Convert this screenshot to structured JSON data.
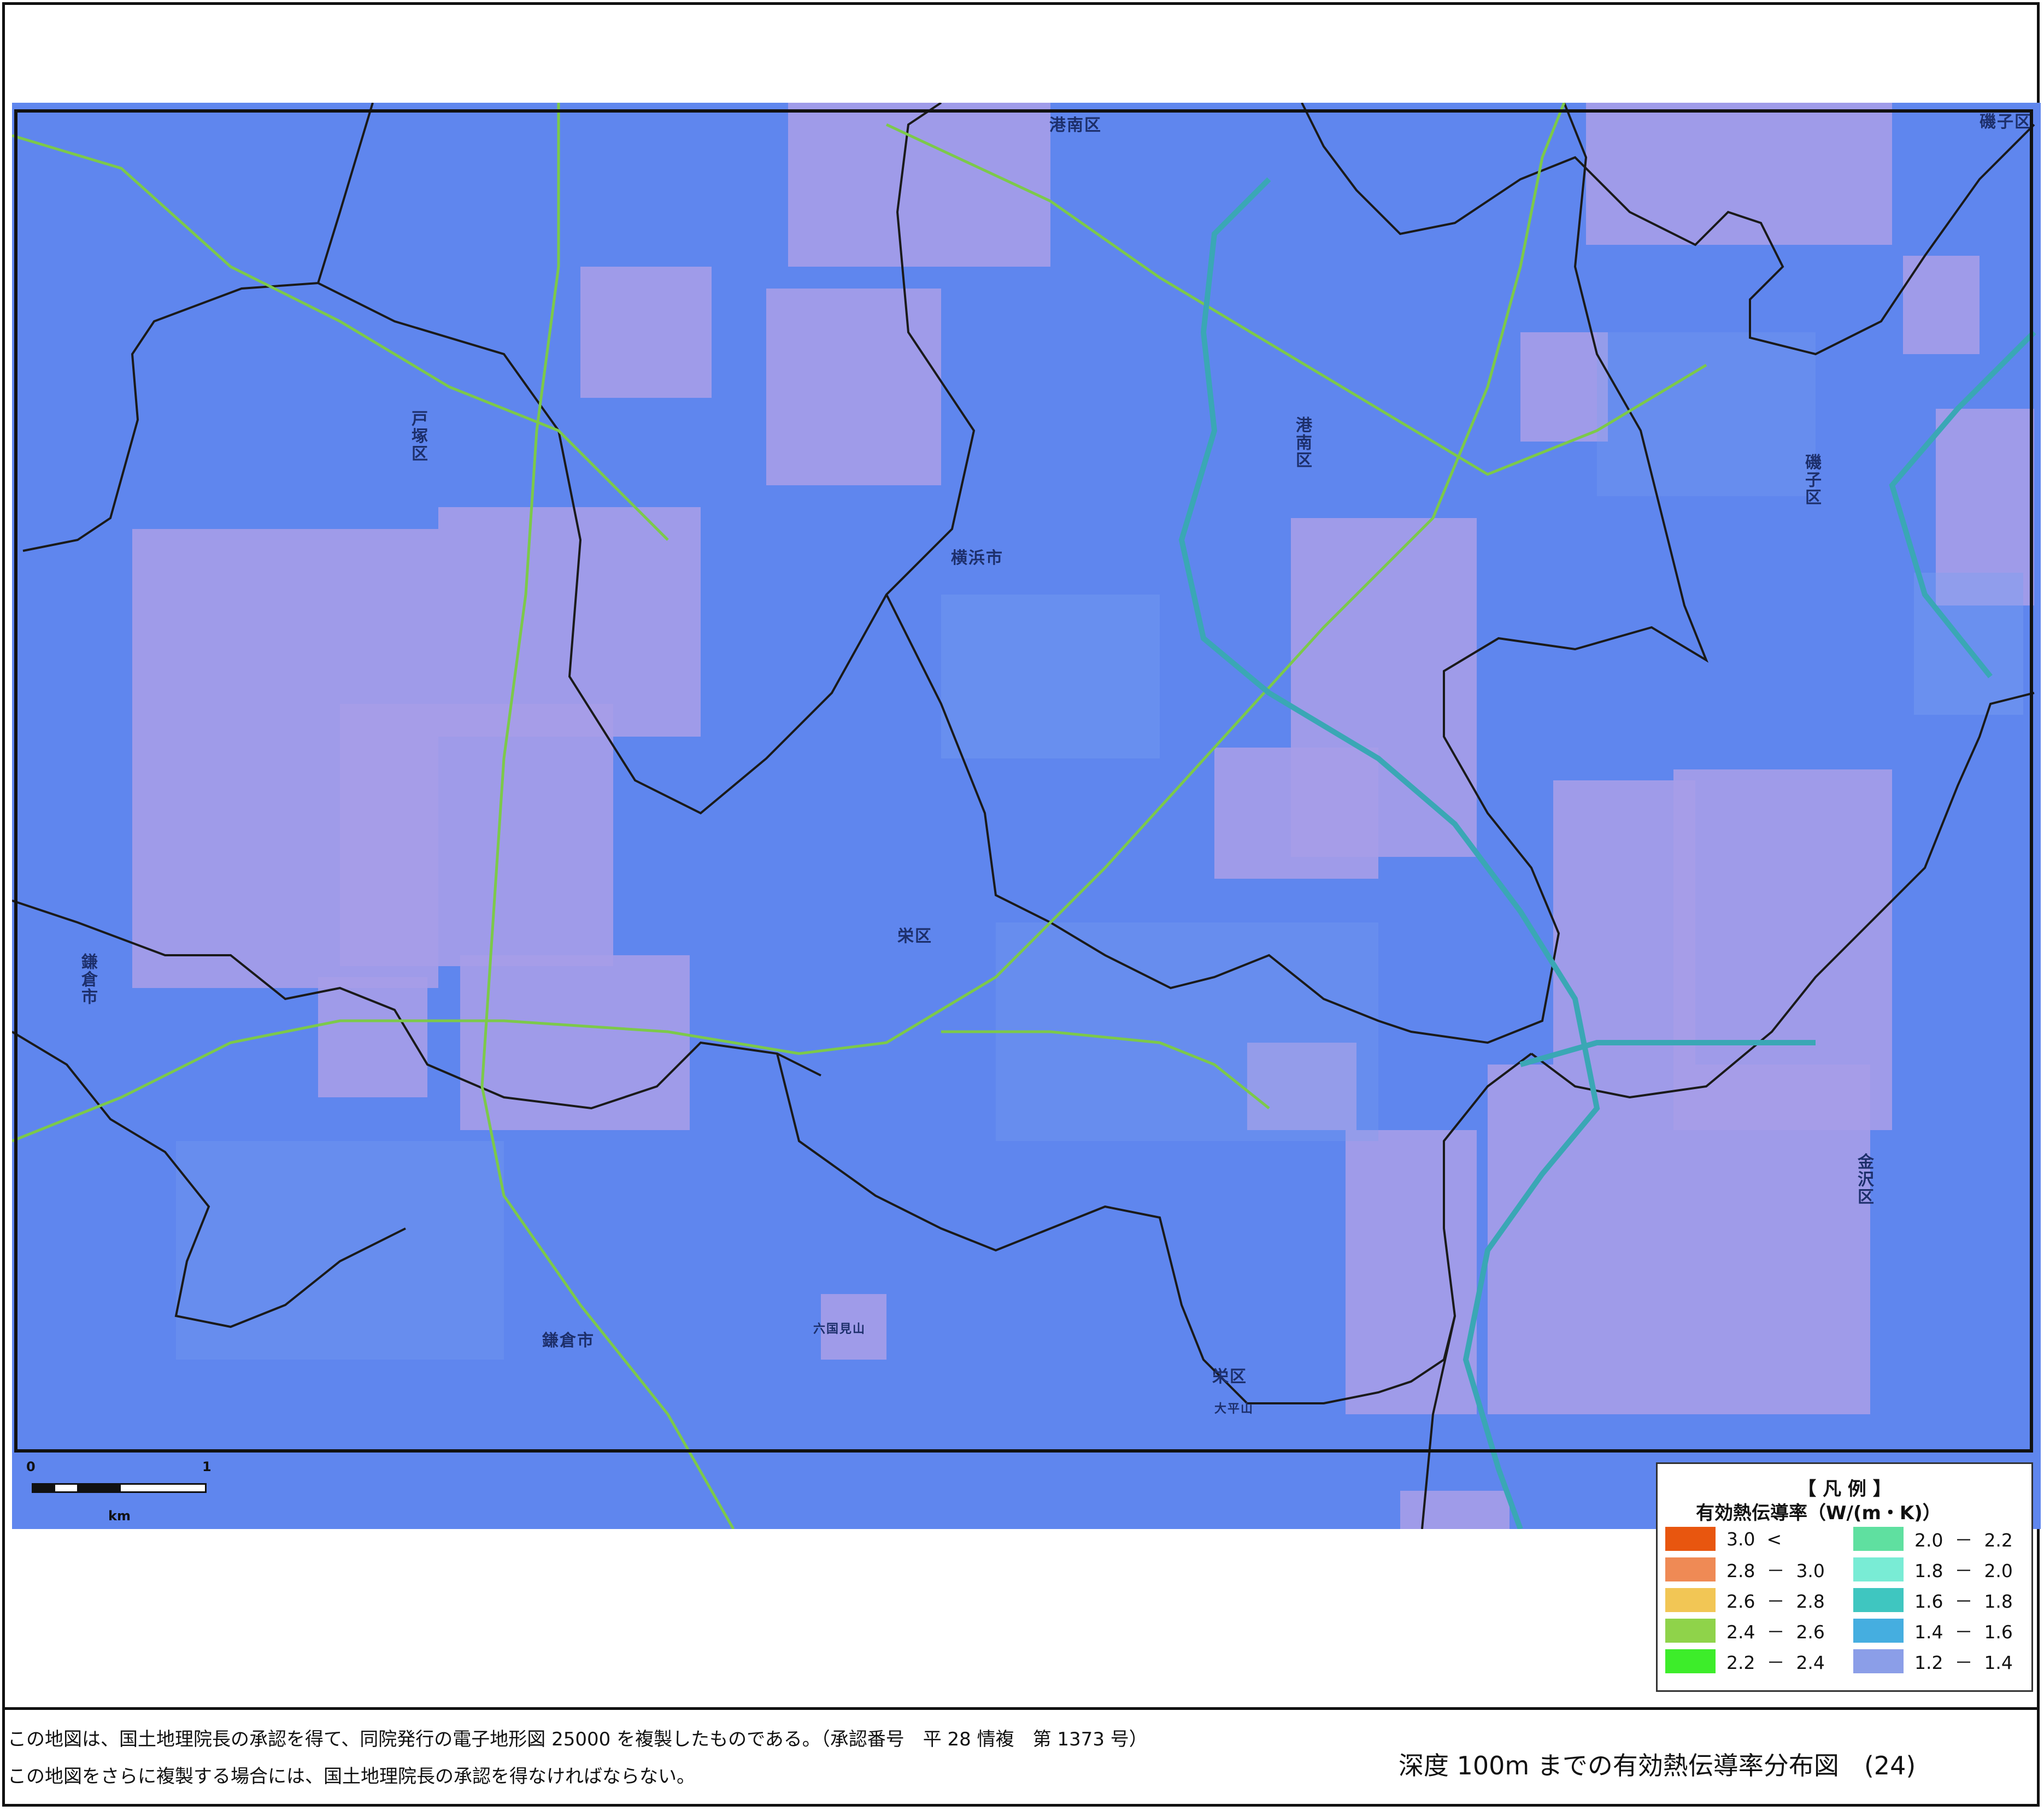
{
  "map": {
    "place_labels": [
      {
        "text": "港南区",
        "orient": "h"
      },
      {
        "text": "磯子区",
        "orient": "h"
      },
      {
        "text": "戸塚区",
        "orient": "v"
      },
      {
        "text": "港南区",
        "orient": "v"
      },
      {
        "text": "磯子区",
        "orient": "v"
      },
      {
        "text": "横浜市",
        "orient": "h"
      },
      {
        "text": "栄区",
        "orient": "h"
      },
      {
        "text": "鎌倉市",
        "orient": "v"
      },
      {
        "text": "鎌倉市",
        "orient": "h"
      },
      {
        "text": "金沢区",
        "orient": "v"
      },
      {
        "text": "栄区",
        "orient": "h"
      },
      {
        "text": "六国見山",
        "orient": "h"
      },
      {
        "text": "大平山",
        "orient": "h"
      }
    ],
    "colors": {
      "base": "#5f86ee",
      "pink": "#a69de8",
      "light": "#7aa0f0",
      "boundary": "#1a1a1a",
      "rail": "#7cc94a",
      "expressway": "#3aa7b5"
    }
  },
  "scale": {
    "start": "0",
    "end": "1",
    "unit": "km"
  },
  "legend": {
    "title": "【 凡 例 】",
    "subtitle": "有効熱伝導率（W/(m・K)）",
    "items": [
      {
        "label": "3.0  <",
        "color": "#e8560f"
      },
      {
        "label": "2.8  －  3.0",
        "color": "#ef8a55"
      },
      {
        "label": "2.6  －  2.8",
        "color": "#f2c655"
      },
      {
        "label": "2.4  －  2.6",
        "color": "#8fd34a"
      },
      {
        "label": "2.2  －  2.4",
        "color": "#3ded2a"
      },
      {
        "label": "2.0  －  2.2",
        "color": "#5fe0a0"
      },
      {
        "label": "1.8  －  2.0",
        "color": "#79ecd5"
      },
      {
        "label": "1.6  －  1.8",
        "color": "#3fc6c0"
      },
      {
        "label": "1.4  －  1.6",
        "color": "#45aee0"
      },
      {
        "label": "1.2  －  1.4",
        "color": "#8b9ee8"
      }
    ]
  },
  "footer": {
    "note1": "この地図は、国土地理院長の承認を得て、同院発行の電子地形図 25000 を複製したものである。（承認番号　平 28 情複　第 1373 号）",
    "note2": "この地図をさらに複製する場合には、国土地理院長の承認を得なければならない。",
    "title": "深度 100m までの有効熱伝導率分布図　(24)"
  }
}
